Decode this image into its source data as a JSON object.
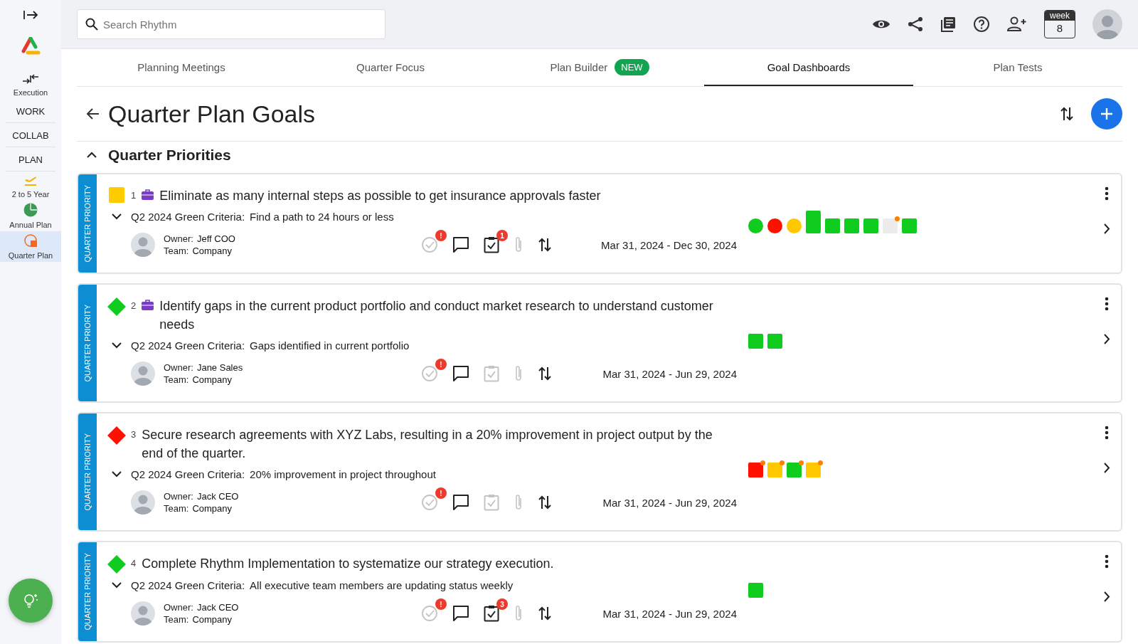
{
  "sidebar": {
    "execution": {
      "label": "Execution"
    },
    "sections": [
      "WORK",
      "COLLAB",
      "PLAN"
    ],
    "plan_items": [
      {
        "kind": "long-term",
        "label": "2 to 5 Year",
        "selected": false
      },
      {
        "kind": "annual",
        "label": "Annual Plan",
        "selected": false
      },
      {
        "kind": "quarter",
        "label": "Quarter Plan",
        "selected": true
      }
    ]
  },
  "topbar": {
    "search": {
      "placeholder": "Search Rhythm"
    },
    "week": {
      "label": "week",
      "number": "8"
    }
  },
  "tabs": [
    {
      "label": "Planning Meetings",
      "selected": false
    },
    {
      "label": "Quarter Focus",
      "selected": false
    },
    {
      "label": "Plan Builder",
      "selected": false,
      "badge": "NEW"
    },
    {
      "label": "Goal Dashboards",
      "selected": true
    },
    {
      "label": "Plan Tests",
      "selected": false
    }
  ],
  "page": {
    "title": "Quarter Plan Goals",
    "section": {
      "title": "Quarter Priorities",
      "expanded": true
    }
  },
  "goals": [
    {
      "side_label": "QUARTER PRIORITY",
      "kind": "square",
      "color": "#ffcc00",
      "number": "1",
      "briefcase": true,
      "title": "Eliminate as many internal steps as possible to get insurance approvals faster",
      "criteria_label": "Q2 2024 Green Criteria:",
      "criteria": "Find a path to 24 hours or less",
      "owner_label": "Owner:",
      "owner": "Jeff COO",
      "team_label": "Team:",
      "team": "Company",
      "check_badge": "!",
      "tasks_active": true,
      "tasks_badge": "1",
      "dates": "Mar 31, 2024 - Dec 30, 2024",
      "markers": [
        {
          "kind": "circle",
          "color": "#10cc1e",
          "flagged": false
        },
        {
          "kind": "circle",
          "color": "#ff1100",
          "flagged": false
        },
        {
          "kind": "circle",
          "color": "#ffc800",
          "flagged": false
        },
        {
          "kind": "tall",
          "color": "#10cc1e",
          "flagged": false
        },
        {
          "kind": "square",
          "color": "#10cc1e",
          "flagged": false
        },
        {
          "kind": "square",
          "color": "#10cc1e",
          "flagged": false
        },
        {
          "kind": "square",
          "color": "#10cc1e",
          "flagged": false
        },
        {
          "kind": "square",
          "color": "#ececec",
          "flagged": true
        },
        {
          "kind": "square",
          "color": "#10cc1e",
          "flagged": false
        }
      ]
    },
    {
      "side_label": "QUARTER PRIORITY",
      "kind": "diamond",
      "color": "#10cc1e",
      "number": "2",
      "briefcase": true,
      "title": "Identify gaps in the current product portfolio and conduct market research to understand customer needs",
      "criteria_label": "Q2 2024 Green Criteria:",
      "criteria": "Gaps identified in current portfolio",
      "owner_label": "Owner:",
      "owner": "Jane Sales",
      "team_label": "Team:",
      "team": "Company",
      "check_badge": "!",
      "tasks_active": false,
      "dates": "Mar 31, 2024 - Jun 29, 2024",
      "markers": [
        {
          "kind": "square",
          "color": "#10cc1e",
          "flagged": false
        },
        {
          "kind": "square",
          "color": "#10cc1e",
          "flagged": false
        }
      ]
    },
    {
      "side_label": "QUARTER PRIORITY",
      "kind": "diamond",
      "color": "#ff1100",
      "number": "3",
      "briefcase": false,
      "title": "Secure research agreements with XYZ Labs, resulting in a 20% improvement in project output by the end of the quarter.",
      "criteria_label": "Q2 2024 Green Criteria:",
      "criteria": "20% improvement in project throughout",
      "owner_label": "Owner:",
      "owner": "Jack CEO",
      "team_label": "Team:",
      "team": "Company",
      "check_badge": "!",
      "tasks_active": false,
      "dates": "Mar 31, 2024 - Jun 29, 2024",
      "markers": [
        {
          "kind": "square",
          "color": "#ff1100",
          "flagged": true
        },
        {
          "kind": "square",
          "color": "#ffc800",
          "flagged": true
        },
        {
          "kind": "square",
          "color": "#10cc1e",
          "flagged": true
        },
        {
          "kind": "square",
          "color": "#ffc800",
          "flagged": true
        }
      ]
    },
    {
      "side_label": "QUARTER PRIORITY",
      "kind": "diamond",
      "color": "#10cc1e",
      "number": "4",
      "briefcase": false,
      "title": "Complete Rhythm Implementation to systematize our strategy execution.",
      "criteria_label": "Q2 2024 Green Criteria:",
      "criteria": "All executive team members are updating status weekly",
      "owner_label": "Owner:",
      "owner": "Jack CEO",
      "team_label": "Team:",
      "team": "Company",
      "check_badge": "!",
      "tasks_active": true,
      "tasks_badge": "3",
      "dates": "Mar 31, 2024 - Jun 29, 2024",
      "markers": [
        {
          "kind": "square",
          "color": "#10cc1e",
          "flagged": false
        }
      ]
    }
  ]
}
